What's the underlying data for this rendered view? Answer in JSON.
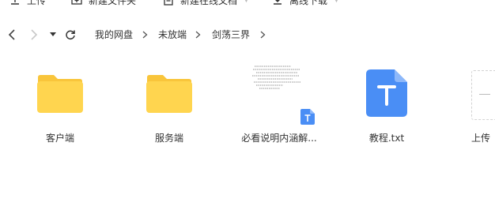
{
  "toolbar": {
    "items": [
      {
        "label": "上传",
        "icon": "upload-icon"
      },
      {
        "label": "新建文件夹",
        "icon": "new-folder-icon"
      },
      {
        "label": "新建在线文档",
        "icon": "new-online-doc-icon"
      },
      {
        "label": "离线下载",
        "icon": "offline-download-icon"
      }
    ]
  },
  "nav": {
    "breadcrumbs": [
      "我的网盘",
      "未放端",
      "剑荡三界"
    ]
  },
  "files": [
    {
      "name": "客户端",
      "type": "folder"
    },
    {
      "name": "服务端",
      "type": "folder"
    },
    {
      "name": "必看说明内涵解...",
      "type": "document"
    },
    {
      "name": "教程.txt",
      "type": "txt"
    },
    {
      "name": "上传",
      "type": "upload"
    }
  ],
  "colors": {
    "folder": "#FFD54F",
    "folder_tab": "#F9C53B",
    "txt_blue": "#4A8EF5",
    "txt_fold": "#8DB8FA"
  }
}
